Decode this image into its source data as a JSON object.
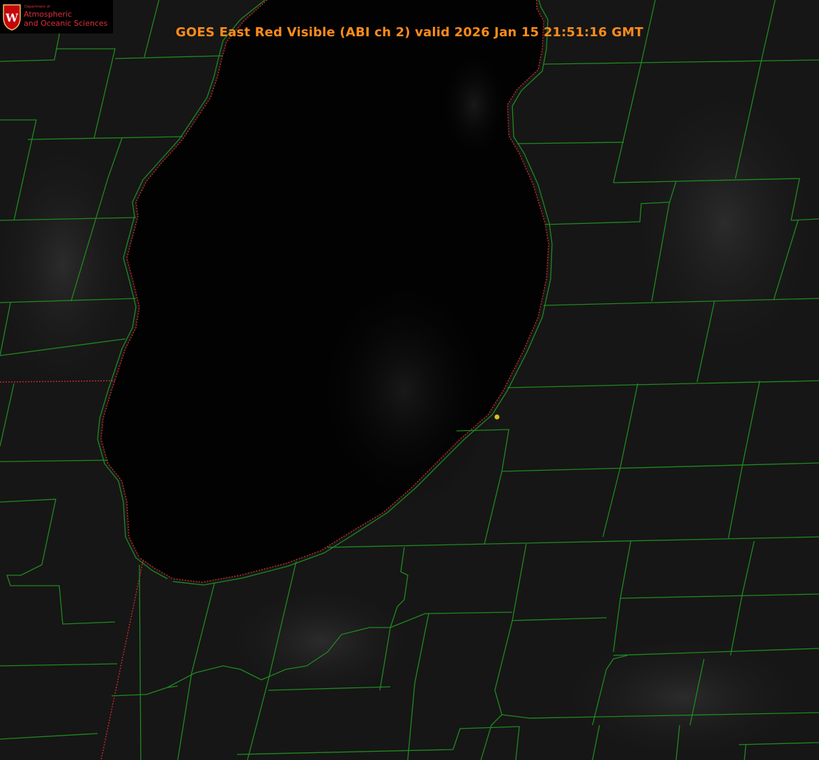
{
  "header": {
    "title": "GOES East Red Visible (ABI ch 2) valid 2026 Jan 15 21:51:16 GMT"
  },
  "logo": {
    "dept": "Department of",
    "line1": "Atmospheric",
    "line2": "and Oceanic Sciences",
    "seal_letter": "W"
  },
  "colors": {
    "background": "#141414",
    "lake": "#020202",
    "county_lines": "#1f8a1f",
    "state_border": "#cc2a2a",
    "title": "#ff8c1a",
    "marker": "#d4c11f",
    "logo_text": "#e0303a"
  },
  "map": {
    "features": [
      "lake-michigan",
      "county-boundaries",
      "state-borders",
      "location-marker"
    ]
  }
}
